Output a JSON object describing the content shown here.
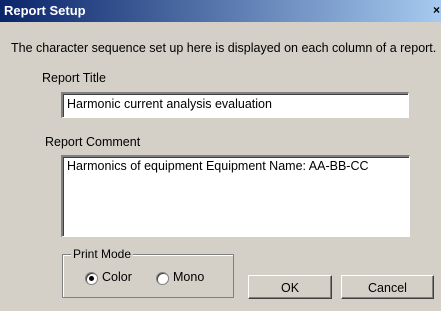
{
  "window": {
    "title": "Report Setup",
    "close_glyph": "×"
  },
  "description": "The character sequence set up here is displayed on each column of a report.",
  "report_title": {
    "label": "Report Title",
    "value": "Harmonic current analysis evaluation"
  },
  "report_comment": {
    "label": "Report Comment",
    "value": "Harmonics of equipment   Equipment Name: AA-BB-CC"
  },
  "print_mode": {
    "label": "Print Mode",
    "options": [
      {
        "label": "Color",
        "selected": true
      },
      {
        "label": "Mono",
        "selected": false
      }
    ]
  },
  "buttons": {
    "ok": "OK",
    "cancel": "Cancel"
  },
  "colors": {
    "dialog_bg": "#d4d0c8",
    "titlebar_start": "#0a246a",
    "titlebar_end": "#a6caf0"
  }
}
